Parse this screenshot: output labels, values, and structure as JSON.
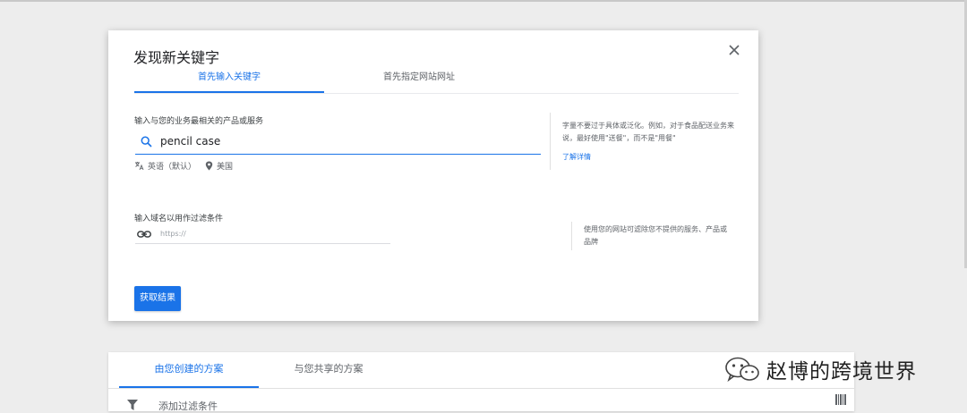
{
  "dialog": {
    "title": "发现新关键字",
    "tabs": [
      {
        "label": "首先输入关键字",
        "active": true
      },
      {
        "label": "首先指定网站网址",
        "active": false
      }
    ],
    "keyword_section": {
      "label": "输入与您的业务最相关的产品或服务",
      "search_value": "pencil case",
      "language": "英语（默认）",
      "location": "美国",
      "tip": "字量不要过于具体或泛化。例如，对于食品配送业务来说，最好使用\"送餐\"，而不是\"用餐\"",
      "learn_more": "了解详情"
    },
    "domain_section": {
      "label": "输入域名以用作过滤条件",
      "placeholder": "https://",
      "tip": "使用您的网站可滤除您不提供的服务、产品或品牌"
    },
    "submit_label": "获取结果"
  },
  "background": {
    "tabs": [
      {
        "label": "由您创建的方案",
        "active": true
      },
      {
        "label": "与您共享的方案",
        "active": false
      }
    ],
    "filter_label": "添加过滤条件"
  },
  "watermark": {
    "text": "赵博的跨境世界"
  },
  "colors": {
    "accent": "#1a73e8",
    "backdrop": "#ededed"
  },
  "icons": [
    "close-icon",
    "search-icon",
    "translate-icon",
    "location-pin-icon",
    "link-icon",
    "filter-icon",
    "barcode-icon",
    "wechat-icon"
  ]
}
